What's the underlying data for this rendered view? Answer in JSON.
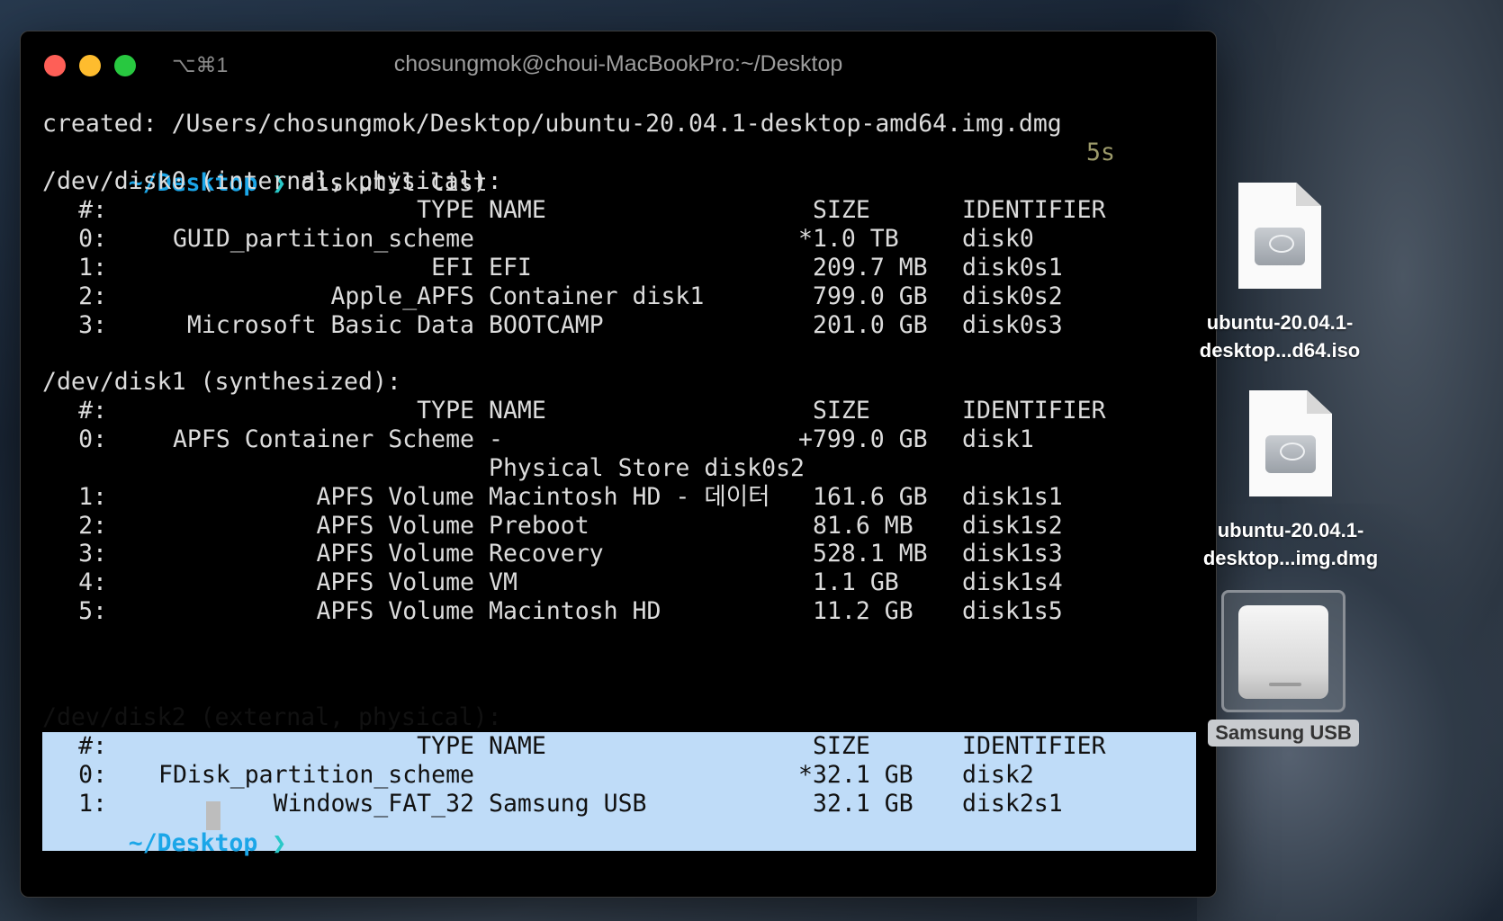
{
  "window": {
    "title": "chosungmok@choui-MacBookPro:~/Desktop",
    "shortcut": "⌥⌘1"
  },
  "terminal": {
    "created_line": "created: /Users/chosungmok/Desktop/ubuntu-20.04.1-desktop-amd64.img.dmg",
    "prompt_dir": "~/Desktop",
    "prompt_arrow": "❯",
    "command": "diskutil list",
    "duration": "5s",
    "col_headers": {
      "num": "#:",
      "type": "TYPE",
      "name": "NAME",
      "size": "SIZE",
      "id": "IDENTIFIER"
    },
    "disk0": {
      "header": "/dev/disk0 (internal, physical):",
      "rows": [
        {
          "num": "0:",
          "type": "GUID_partition_scheme",
          "name": "",
          "size": "*1.0 TB",
          "id": "disk0"
        },
        {
          "num": "1:",
          "type": "EFI",
          "name": "EFI",
          "size": "209.7 MB",
          "id": "disk0s1"
        },
        {
          "num": "2:",
          "type": "Apple_APFS",
          "name": "Container disk1",
          "size": "799.0 GB",
          "id": "disk0s2"
        },
        {
          "num": "3:",
          "type": "Microsoft Basic Data",
          "name": "BOOTCAMP",
          "size": "201.0 GB",
          "id": "disk0s3"
        }
      ]
    },
    "disk1": {
      "header": "/dev/disk1 (synthesized):",
      "rows": [
        {
          "num": "0:",
          "type": "APFS Container Scheme",
          "name": "-",
          "size": "+799.0 GB",
          "id": "disk1"
        },
        {
          "num": "",
          "type": "",
          "name": "Physical Store disk0s2",
          "size": "",
          "id": ""
        },
        {
          "num": "1:",
          "type": "APFS Volume",
          "name": "Macintosh HD - 데이터",
          "size": "161.6 GB",
          "id": "disk1s1"
        },
        {
          "num": "2:",
          "type": "APFS Volume",
          "name": "Preboot",
          "size": "81.6 MB",
          "id": "disk1s2"
        },
        {
          "num": "3:",
          "type": "APFS Volume",
          "name": "Recovery",
          "size": "528.1 MB",
          "id": "disk1s3"
        },
        {
          "num": "4:",
          "type": "APFS Volume",
          "name": "VM",
          "size": "1.1 GB",
          "id": "disk1s4"
        },
        {
          "num": "5:",
          "type": "APFS Volume",
          "name": "Macintosh HD",
          "size": "11.2 GB",
          "id": "disk1s5"
        }
      ]
    },
    "disk2": {
      "header": "/dev/disk2 (external, physical):",
      "rows": [
        {
          "num": "0:",
          "type": "FDisk_partition_scheme",
          "name": "",
          "size": "*32.1 GB",
          "id": "disk2"
        },
        {
          "num": "1:",
          "type": "Windows_FAT_32",
          "name": "Samsung USB",
          "size": "32.1 GB",
          "id": "disk2s1"
        }
      ]
    }
  },
  "desktop": {
    "icons": [
      {
        "line1": "ubuntu-20.04.1-",
        "line2": "desktop...d64.iso",
        "icon": "disk-image-icon"
      },
      {
        "line1": "ubuntu-20.04.1-",
        "line2": "desktop...img.dmg",
        "icon": "disk-image-icon"
      }
    ],
    "usb": {
      "label": "Samsung USB",
      "icon": "external-drive-icon"
    }
  },
  "colors": {
    "prompt_dir": "#1ba6e8",
    "selection": "#bfdcf8",
    "close": "#fe5f57",
    "minimize": "#febc2e",
    "maximize": "#28c840"
  }
}
